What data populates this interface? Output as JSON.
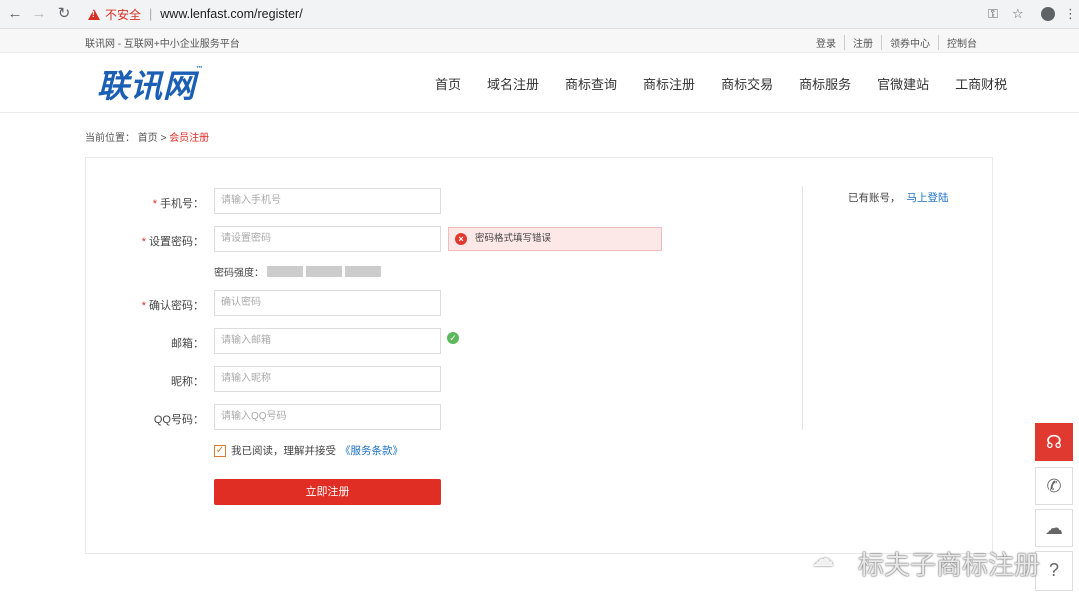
{
  "browser": {
    "security_label": "不安全",
    "url": "www.lenfast.com/register/"
  },
  "topbar": {
    "tagline": "联讯网 - 互联网+中小企业服务平台",
    "links": [
      "登录",
      "注册",
      "领券中心",
      "控制台"
    ]
  },
  "header": {
    "logo_text": "联讯网",
    "logo_tm": "™",
    "nav": [
      "首页",
      "域名注册",
      "商标查询",
      "商标注册",
      "商标交易",
      "商标服务",
      "官微建站",
      "工商财税"
    ]
  },
  "breadcrumb": {
    "prefix": "当前位置：",
    "home": "首页",
    "sep": ">",
    "current": "会员注册"
  },
  "form": {
    "phone_label": "手机号：",
    "phone_placeholder": "请输入手机号",
    "password_label": "设置密码：",
    "password_placeholder": "请设置密码",
    "password_error": "密码格式填写错误",
    "strength_label": "密码强度：",
    "confirm_label": "确认密码：",
    "confirm_placeholder": "确认密码",
    "email_label": "邮箱：",
    "email_placeholder": "请输入邮箱",
    "nickname_label": "昵称：",
    "nickname_placeholder": "请输入昵称",
    "qq_label": "QQ号码：",
    "qq_placeholder": "请输入QQ号码",
    "required_mark": "*",
    "agree_text": "我已阅读，理解并接受",
    "terms_link": "《服务条款》",
    "submit_label": "立即注册"
  },
  "login": {
    "text": "已有账号，",
    "link": "马上登陆"
  },
  "watermark": {
    "text": "标夫子商标注册"
  }
}
